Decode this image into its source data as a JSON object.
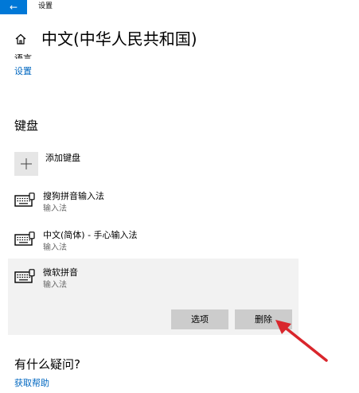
{
  "titlebar": {
    "back_glyph": "←",
    "title": "设置"
  },
  "header": {
    "home_icon": "home-icon",
    "title": "中文(中华人民共和国)"
  },
  "language_options": {
    "clipped_label": "语言",
    "settings_link": "设置"
  },
  "keyboard": {
    "heading": "键盘",
    "add_label": "添加键盘",
    "items": [
      {
        "name": "搜狗拼音输入法",
        "type": "输入法"
      },
      {
        "name": "中文(简体) - 手心输入法",
        "type": "输入法"
      },
      {
        "name": "微软拼音",
        "type": "输入法",
        "selected": true
      }
    ],
    "options_label": "选项",
    "delete_label": "删除"
  },
  "help": {
    "heading": "有什么疑问?",
    "link": "获取帮助"
  },
  "colors": {
    "accent": "#0078d7",
    "link": "#0067c0",
    "annotation_arrow": "#d9262c"
  }
}
